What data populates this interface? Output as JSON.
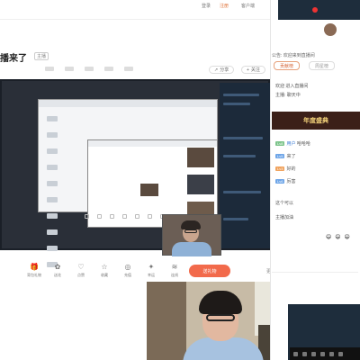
{
  "topbar": {
    "links": [
      "登录",
      "注册",
      "客户端"
    ]
  },
  "header": {
    "title": "播来了",
    "badge": "主播",
    "share_label": "分享",
    "follow_label": "关注"
  },
  "toolbar": {
    "items": [
      {
        "icon": "gift-icon",
        "label": "背包礼物"
      },
      {
        "icon": "flower-icon",
        "label": "送花"
      },
      {
        "icon": "heart-icon",
        "label": "点赞"
      },
      {
        "icon": "star-icon",
        "label": "收藏"
      },
      {
        "icon": "coin-icon",
        "label": "充值"
      },
      {
        "icon": "lucky-icon",
        "label": "幸运"
      },
      {
        "icon": "wifi-icon",
        "label": "连线"
      }
    ],
    "send_gift": "送礼物",
    "more": "更多"
  },
  "right_panel": {
    "tabs": [
      "贡献榜",
      "周星榜"
    ],
    "chat_lines": [
      {
        "badge": "",
        "name": "",
        "text": "公告: 欢迎来到直播间"
      },
      {
        "badge": "",
        "name": "",
        "text": "欢迎 进入直播间"
      },
      {
        "badge": "",
        "name": "",
        "text": "主播: 聊天中"
      }
    ],
    "banner": "年度盛典",
    "messages": [
      {
        "badge": "Lv8",
        "name": "用户",
        "text": "哈哈哈"
      },
      {
        "badge": "Lv5",
        "name": "",
        "text": "来了"
      },
      {
        "badge": "Lv3",
        "name": "",
        "text": "好的"
      },
      {
        "badge": "Lv6",
        "name": "",
        "text": "厉害"
      },
      {
        "badge": "",
        "name": "",
        "text": "这个可以"
      },
      {
        "badge": "",
        "name": "",
        "text": "主播加油"
      }
    ],
    "emojis": [
      "😄",
      "😄",
      "😄"
    ]
  },
  "colors": {
    "accent": "#f26a4b",
    "stream_bg": "#1a1f27",
    "panel_dark": "#1e2d3c"
  }
}
